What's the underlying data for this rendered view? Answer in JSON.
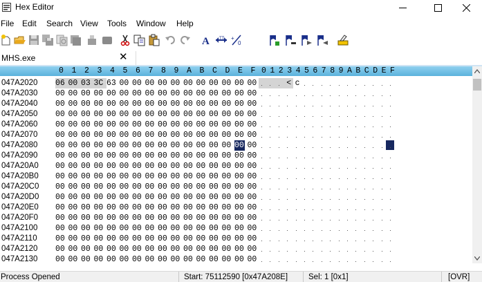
{
  "window": {
    "title": "Hex Editor",
    "minimize_glyph": "—",
    "maximize_glyph": "☐",
    "close_glyph": "✕"
  },
  "menu": [
    "File",
    "Edit",
    "Search",
    "View",
    "Tools",
    "Window",
    "Help"
  ],
  "toolbar": {
    "icons": [
      "new-file-icon",
      "open-folder-icon",
      "save-icon",
      "save-all-icon",
      "save-copy-icon",
      "print-icon",
      "print-preview-icon",
      "close-file-icon",
      "cut-icon",
      "copy-icon",
      "paste-icon",
      "undo-icon",
      "redo-icon",
      "font-icon",
      "width-icon",
      "zero-fill-icon",
      "bookmark-add-icon",
      "bookmark-remove-icon",
      "bookmark-next-icon",
      "bookmark-prev-icon",
      "highlight-icon"
    ]
  },
  "tab": {
    "label": "MHS.exe",
    "close_glyph": "✕"
  },
  "hex_header": {
    "hex_columns": [
      "0",
      "1",
      "2",
      "3",
      "4",
      "5",
      "6",
      "7",
      "8",
      "9",
      "A",
      "B",
      "C",
      "D",
      "E",
      "F"
    ],
    "text_columns": [
      "0",
      "1",
      "2",
      "3",
      "4",
      "5",
      "6",
      "7",
      "8",
      "9",
      "A",
      "B",
      "C",
      "D",
      "E",
      "F"
    ]
  },
  "rows": [
    {
      "address": "047A2020",
      "bytes": [
        "06",
        "00",
        "03",
        "3C",
        "63",
        "00",
        "00",
        "00",
        "00",
        "00",
        "00",
        "00",
        "00",
        "00",
        "00",
        "00"
      ],
      "text": [
        "",
        "",
        "",
        "<",
        "c",
        "",
        "",
        "",
        "",
        "",
        "",
        "",
        "",
        "",
        "",
        ""
      ]
    },
    {
      "address": "047A2030",
      "bytes": [
        "00",
        "00",
        "00",
        "00",
        "00",
        "00",
        "00",
        "00",
        "00",
        "00",
        "00",
        "00",
        "00",
        "00",
        "00",
        "00"
      ],
      "text": [
        "",
        "",
        "",
        "",
        "",
        "",
        "",
        "",
        "",
        "",
        "",
        "",
        "",
        "",
        "",
        ""
      ]
    },
    {
      "address": "047A2040",
      "bytes": [
        "00",
        "00",
        "00",
        "00",
        "00",
        "00",
        "00",
        "00",
        "00",
        "00",
        "00",
        "00",
        "00",
        "00",
        "00",
        "00"
      ],
      "text": [
        "",
        "",
        "",
        "",
        "",
        "",
        "",
        "",
        "",
        "",
        "",
        "",
        "",
        "",
        "",
        ""
      ]
    },
    {
      "address": "047A2050",
      "bytes": [
        "00",
        "00",
        "00",
        "00",
        "00",
        "00",
        "00",
        "00",
        "00",
        "00",
        "00",
        "00",
        "00",
        "00",
        "00",
        "00"
      ],
      "text": [
        "",
        "",
        "",
        "",
        "",
        "",
        "",
        "",
        "",
        "",
        "",
        "",
        "",
        "",
        "",
        ""
      ]
    },
    {
      "address": "047A2060",
      "bytes": [
        "00",
        "00",
        "00",
        "00",
        "00",
        "00",
        "00",
        "00",
        "00",
        "00",
        "00",
        "00",
        "00",
        "00",
        "00",
        "00"
      ],
      "text": [
        "",
        "",
        "",
        "",
        "",
        "",
        "",
        "",
        "",
        "",
        "",
        "",
        "",
        "",
        "",
        ""
      ]
    },
    {
      "address": "047A2070",
      "bytes": [
        "00",
        "00",
        "00",
        "00",
        "00",
        "00",
        "00",
        "00",
        "00",
        "00",
        "00",
        "00",
        "00",
        "00",
        "00",
        "00"
      ],
      "text": [
        "",
        "",
        "",
        "",
        "",
        "",
        "",
        "",
        "",
        "",
        "",
        "",
        "",
        "",
        "",
        ""
      ]
    },
    {
      "address": "047A2080",
      "bytes": [
        "00",
        "00",
        "00",
        "00",
        "00",
        "00",
        "00",
        "00",
        "00",
        "00",
        "00",
        "00",
        "00",
        "00",
        "00",
        "00"
      ],
      "text": [
        "",
        "",
        "",
        "",
        "",
        "",
        "",
        "",
        "",
        "",
        "",
        "",
        "",
        "",
        "",
        ""
      ]
    },
    {
      "address": "047A2090",
      "bytes": [
        "00",
        "00",
        "00",
        "00",
        "00",
        "00",
        "00",
        "00",
        "00",
        "00",
        "00",
        "00",
        "00",
        "00",
        "00",
        "00"
      ],
      "text": [
        "",
        "",
        "",
        "",
        "",
        "",
        "",
        "",
        "",
        "",
        "",
        "",
        "",
        "",
        "",
        ""
      ]
    },
    {
      "address": "047A20A0",
      "bytes": [
        "00",
        "00",
        "00",
        "00",
        "00",
        "00",
        "00",
        "00",
        "00",
        "00",
        "00",
        "00",
        "00",
        "00",
        "00",
        "00"
      ],
      "text": [
        "",
        "",
        "",
        "",
        "",
        "",
        "",
        "",
        "",
        "",
        "",
        "",
        "",
        "",
        "",
        ""
      ]
    },
    {
      "address": "047A20B0",
      "bytes": [
        "00",
        "00",
        "00",
        "00",
        "00",
        "00",
        "00",
        "00",
        "00",
        "00",
        "00",
        "00",
        "00",
        "00",
        "00",
        "00"
      ],
      "text": [
        "",
        "",
        "",
        "",
        "",
        "",
        "",
        "",
        "",
        "",
        "",
        "",
        "",
        "",
        "",
        ""
      ]
    },
    {
      "address": "047A20C0",
      "bytes": [
        "00",
        "00",
        "00",
        "00",
        "00",
        "00",
        "00",
        "00",
        "00",
        "00",
        "00",
        "00",
        "00",
        "00",
        "00",
        "00"
      ],
      "text": [
        "",
        "",
        "",
        "",
        "",
        "",
        "",
        "",
        "",
        "",
        "",
        "",
        "",
        "",
        "",
        ""
      ]
    },
    {
      "address": "047A20D0",
      "bytes": [
        "00",
        "00",
        "00",
        "00",
        "00",
        "00",
        "00",
        "00",
        "00",
        "00",
        "00",
        "00",
        "00",
        "00",
        "00",
        "00"
      ],
      "text": [
        "",
        "",
        "",
        "",
        "",
        "",
        "",
        "",
        "",
        "",
        "",
        "",
        "",
        "",
        "",
        ""
      ]
    },
    {
      "address": "047A20E0",
      "bytes": [
        "00",
        "00",
        "00",
        "00",
        "00",
        "00",
        "00",
        "00",
        "00",
        "00",
        "00",
        "00",
        "00",
        "00",
        "00",
        "00"
      ],
      "text": [
        "",
        "",
        "",
        "",
        "",
        "",
        "",
        "",
        "",
        "",
        "",
        "",
        "",
        "",
        "",
        ""
      ]
    },
    {
      "address": "047A20F0",
      "bytes": [
        "00",
        "00",
        "00",
        "00",
        "00",
        "00",
        "00",
        "00",
        "00",
        "00",
        "00",
        "00",
        "00",
        "00",
        "00",
        "00"
      ],
      "text": [
        "",
        "",
        "",
        "",
        "",
        "",
        "",
        "",
        "",
        "",
        "",
        "",
        "",
        "",
        "",
        ""
      ]
    },
    {
      "address": "047A2100",
      "bytes": [
        "00",
        "00",
        "00",
        "00",
        "00",
        "00",
        "00",
        "00",
        "00",
        "00",
        "00",
        "00",
        "00",
        "00",
        "00",
        "00"
      ],
      "text": [
        "",
        "",
        "",
        "",
        "",
        "",
        "",
        "",
        "",
        "",
        "",
        "",
        "",
        "",
        "",
        ""
      ]
    },
    {
      "address": "047A2110",
      "bytes": [
        "00",
        "00",
        "00",
        "00",
        "00",
        "00",
        "00",
        "00",
        "00",
        "00",
        "00",
        "00",
        "00",
        "00",
        "00",
        "00"
      ],
      "text": [
        "",
        "",
        "",
        "",
        "",
        "",
        "",
        "",
        "",
        "",
        "",
        "",
        "",
        "",
        "",
        ""
      ]
    },
    {
      "address": "047A2120",
      "bytes": [
        "00",
        "00",
        "00",
        "00",
        "00",
        "00",
        "00",
        "00",
        "00",
        "00",
        "00",
        "00",
        "00",
        "00",
        "00",
        "00"
      ],
      "text": [
        "",
        "",
        "",
        "",
        "",
        "",
        "",
        "",
        "",
        "",
        "",
        "",
        "",
        "",
        "",
        ""
      ]
    },
    {
      "address": "047A2130",
      "bytes": [
        "00",
        "00",
        "00",
        "00",
        "00",
        "00",
        "00",
        "00",
        "00",
        "00",
        "00",
        "00",
        "00",
        "00",
        "00",
        "00"
      ],
      "text": [
        "",
        "",
        "",
        "",
        "",
        "",
        "",
        "",
        "",
        "",
        "",
        "",
        "",
        "",
        "",
        ""
      ]
    }
  ],
  "selection": {
    "highlighted_row": 0,
    "highlighted_bytes": [
      0,
      1,
      2,
      3
    ],
    "cursor_row": 6,
    "cursor_col": 14
  },
  "colors": {
    "header_gradient_top": "#8fd0ef",
    "header_gradient_bottom": "#5bb2dc",
    "selection_gray": "#d4d4d4",
    "cursor_navy": "#17285f"
  },
  "status": {
    "left": "Process Opened",
    "start": "Start: 75112590 [0x47A208E]",
    "sel": "Sel: 1 [0x1]",
    "mode": "[OVR]"
  }
}
